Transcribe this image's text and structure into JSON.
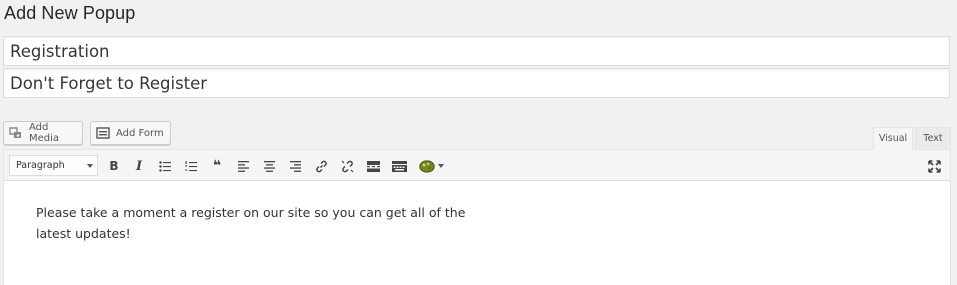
{
  "page": {
    "title": "Add New Popup"
  },
  "fields": {
    "title_value": "Registration",
    "subtitle_value": "Don't Forget to Register"
  },
  "media_buttons": {
    "add_media_label": "Add Media",
    "add_form_label": "Add Form"
  },
  "editor_tabs": {
    "visual_label": "Visual",
    "text_label": "Text",
    "active": "Visual"
  },
  "toolbar": {
    "format_selected": "Paragraph",
    "buttons": [
      "bold",
      "italic",
      "bulleted-list",
      "numbered-list",
      "blockquote",
      "align-left",
      "align-center",
      "align-right",
      "insert-link",
      "remove-link",
      "read-more",
      "toolbar-toggle",
      "popup-shortcode",
      "fullscreen"
    ],
    "bold_glyph": "B",
    "italic_glyph": "I",
    "quote_glyph": "❝"
  },
  "content": {
    "paragraph": "Please take a moment a register on our site so you can get all of the latest updates!"
  },
  "colors": {
    "accent_icon": "#6b8e23",
    "background": "#f1f1f1"
  }
}
